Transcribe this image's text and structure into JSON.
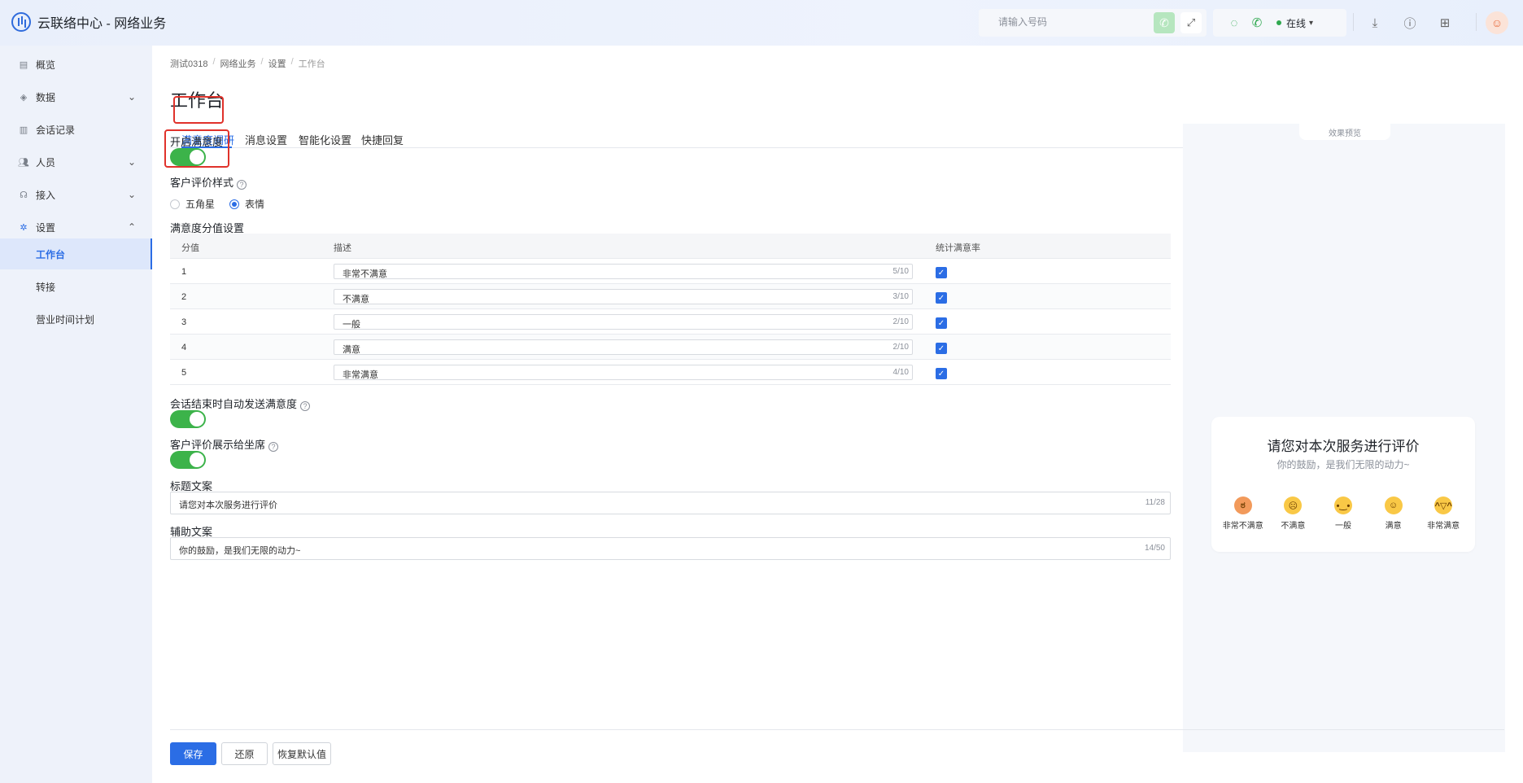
{
  "app": {
    "title": "云联络中心 - 网络业务"
  },
  "topbar": {
    "phone_placeholder": "请输入号码",
    "status": "在线"
  },
  "sidebar": {
    "items": [
      {
        "label": "概览",
        "icon": "overview-icon"
      },
      {
        "label": "数据",
        "icon": "data-icon"
      },
      {
        "label": "会话记录",
        "icon": "session-record-icon"
      },
      {
        "label": "人员",
        "icon": "people-icon"
      },
      {
        "label": "接入",
        "icon": "headset-icon"
      },
      {
        "label": "设置",
        "icon": "gear-icon"
      }
    ],
    "sub_items": [
      {
        "label": "工作台"
      },
      {
        "label": "转接"
      },
      {
        "label": "营业时间计划"
      }
    ]
  },
  "breadcrumb": [
    "测试0318",
    "网络业务",
    "设置",
    "工作台"
  ],
  "page_title": "工作台",
  "tabs": [
    "满意度调研",
    "消息设置",
    "智能化设置",
    "快捷回复"
  ],
  "form": {
    "enable_label": "开启满意度",
    "style_label": "客户评价样式",
    "style_options": [
      "五角星",
      "表情"
    ],
    "style_selected": "表情",
    "score_label": "满意度分值设置",
    "table_headers": [
      "分值",
      "描述",
      "统计满意率"
    ],
    "rows": [
      {
        "score": "1",
        "desc": "非常不满意",
        "count": "5/10",
        "checked": true
      },
      {
        "score": "2",
        "desc": "不满意",
        "count": "3/10",
        "checked": true
      },
      {
        "score": "3",
        "desc": "一般",
        "count": "2/10",
        "checked": true
      },
      {
        "score": "4",
        "desc": "满意",
        "count": "2/10",
        "checked": true
      },
      {
        "score": "5",
        "desc": "非常满意",
        "count": "4/10",
        "checked": true
      }
    ],
    "auto_send_label": "会话结束时自动发送满意度",
    "show_agent_label": "客户评价展示给坐席",
    "title_text_label": "标题文案",
    "title_text_value": "请您对本次服务进行评价",
    "title_text_count": "11/28",
    "sub_text_label": "辅助文案",
    "sub_text_value": "你的鼓励，是我们无限的动力~",
    "sub_text_count": "14/50"
  },
  "buttons": {
    "save": "保存",
    "restore": "还原",
    "reset_default": "恢复默认值"
  },
  "preview": {
    "tab_label": "效果预览",
    "title": "请您对本次服务进行评价",
    "subtitle": "你的鼓励，是我们无限的动力~",
    "emojis": [
      "非常不满意",
      "不满意",
      "一般",
      "满意",
      "非常满意"
    ]
  },
  "colors": {
    "accent": "#2b6de5",
    "toggle_on": "#3cb34a",
    "highlight": "#e0322b"
  }
}
